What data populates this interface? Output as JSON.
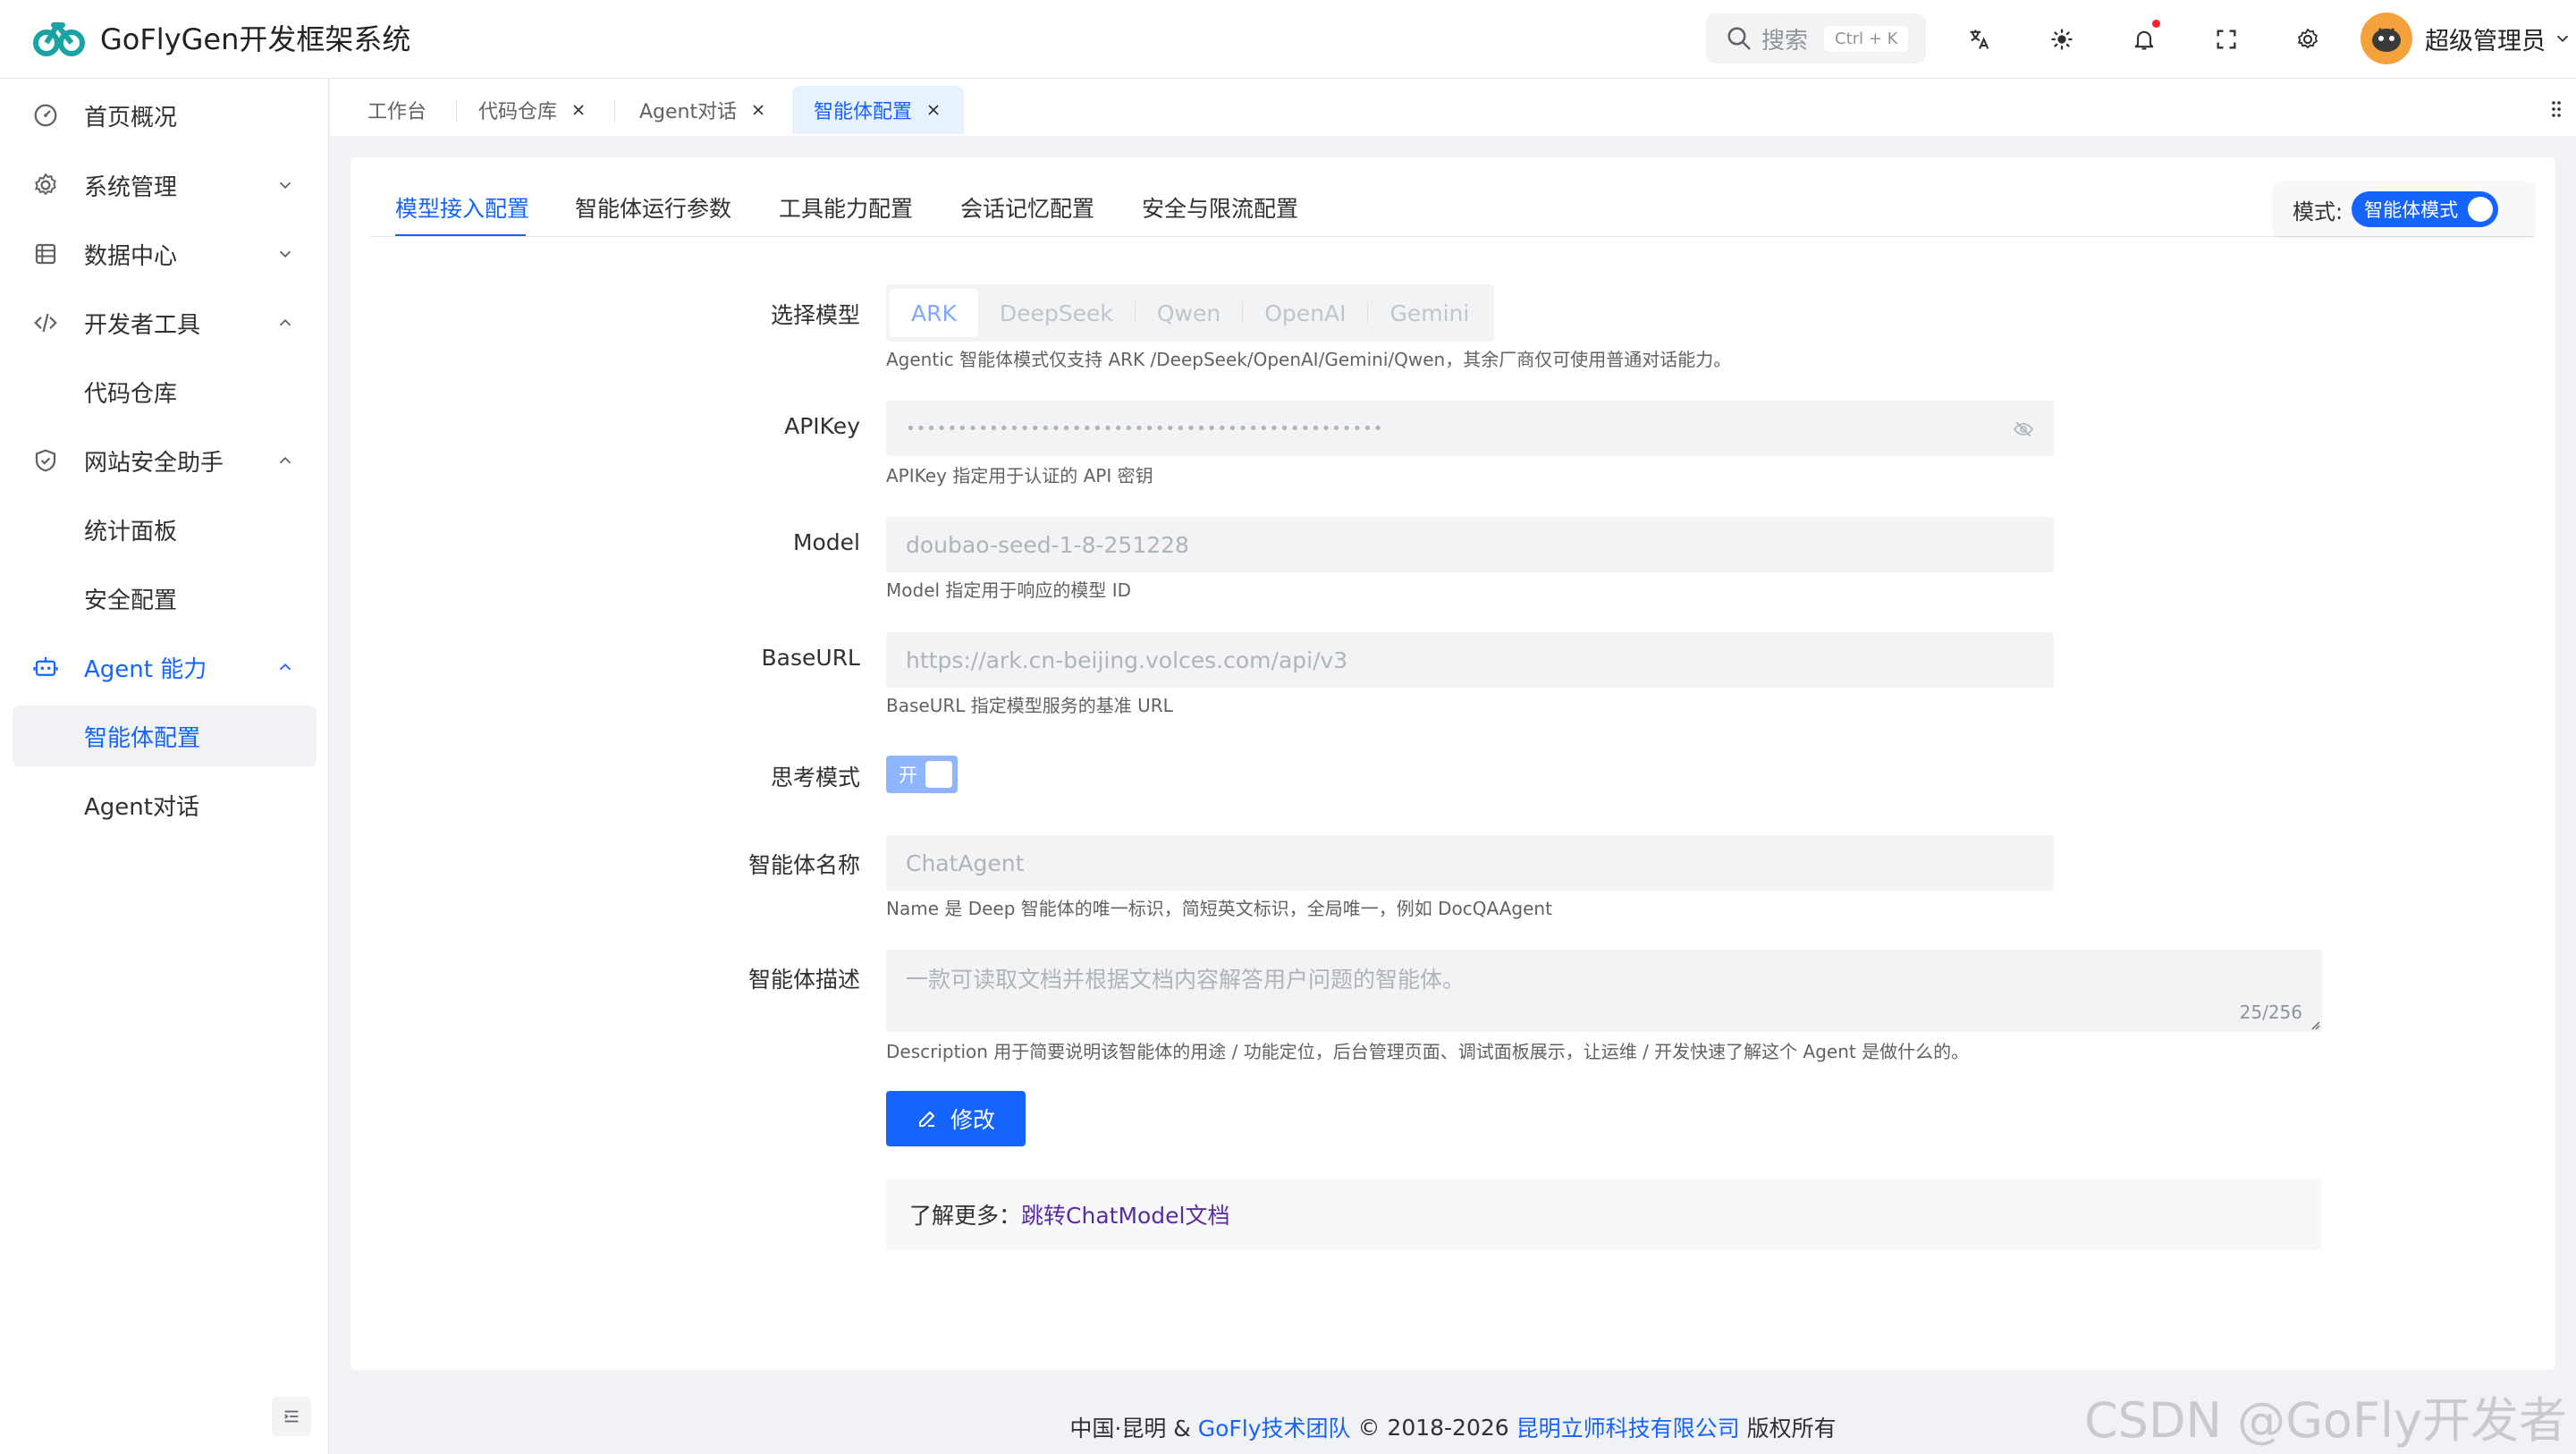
{
  "app": {
    "title": "GoFlyGen开发框架系统"
  },
  "header": {
    "search_label": "搜索",
    "search_shortcut": "Ctrl + K",
    "user_name": "超级管理员"
  },
  "sidebar": {
    "items": [
      {
        "label": "首页概况",
        "icon": "dashboard-icon"
      },
      {
        "label": "系统管理",
        "icon": "gear-icon"
      },
      {
        "label": "数据中心",
        "icon": "database-icon"
      },
      {
        "label": "开发者工具",
        "icon": "code-icon"
      },
      {
        "label": "代码仓库"
      },
      {
        "label": "网站安全助手",
        "icon": "shield-icon"
      },
      {
        "label": "统计面板"
      },
      {
        "label": "安全配置"
      },
      {
        "label": "Agent 能力",
        "icon": "robot-icon"
      },
      {
        "label": "智能体配置"
      },
      {
        "label": "Agent对话"
      }
    ]
  },
  "tabs": [
    {
      "label": "工作台"
    },
    {
      "label": "代码仓库"
    },
    {
      "label": "Agent对话"
    },
    {
      "label": "智能体配置"
    }
  ],
  "config_tabs": [
    "模型接入配置",
    "智能体运行参数",
    "工具能力配置",
    "会话记忆配置",
    "安全与限流配置"
  ],
  "mode": {
    "label": "模式:",
    "value": "智能体模式"
  },
  "form": {
    "model_label": "选择模型",
    "model_options": [
      "ARK",
      "DeepSeek",
      "Qwen",
      "OpenAI",
      "Gemini"
    ],
    "model_help": "Agentic 智能体模式仅支持 ARK /DeepSeek/OpenAI/Gemini/Qwen，其余厂商仅可使用普通对话能力。",
    "apikey_label": "APIKey",
    "apikey_value": "••••••••••••••••••••••••••••••••••••••••••••••",
    "apikey_help": "APIKey 指定用于认证的 API 密钥",
    "model_field_label": "Model",
    "model_field_value": "doubao-seed-1-8-251228",
    "model_field_help": "Model 指定用于响应的模型 ID",
    "baseurl_label": "BaseURL",
    "baseurl_value": "https://ark.cn-beijing.volces.com/api/v3",
    "baseurl_help": "BaseURL 指定模型服务的基准 URL",
    "think_label": "思考模式",
    "think_value": "开",
    "name_label": "智能体名称",
    "name_value": "ChatAgent",
    "name_help": "Name 是 Deep 智能体的唯一标识，简短英文标识，全局唯一，例如 DocQAAgent",
    "desc_label": "智能体描述",
    "desc_value": "一款可读取文档并根据文档内容解答用户问题的智能体。",
    "desc_counter": "25/256",
    "desc_help": "Description 用于简要说明该智能体的用途 / 功能定位，后台管理页面、调试面板展示，让运维 / 开发快速了解这个 Agent 是做什么的。",
    "edit_button": "修改",
    "more_label": "了解更多：",
    "more_link": "跳转ChatModel文档"
  },
  "footer": {
    "prefix": "中国·昆明 &",
    "team": "GoFly技术团队",
    "years": "© 2018-2026",
    "company": "昆明立师科技有限公司",
    "suffix": "版权所有"
  },
  "watermark": "CSDN @GoFly开发者",
  "colors": {
    "primary": "#1664ff",
    "brand_logo": "#1aa3a3"
  }
}
